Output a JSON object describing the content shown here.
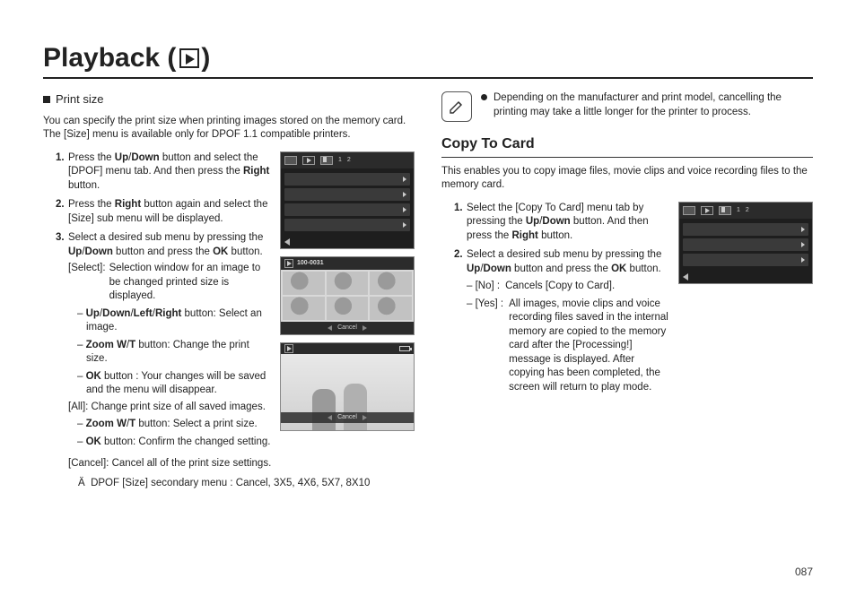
{
  "page": {
    "title_prefix": "Playback (",
    "title_suffix": ")",
    "number": "087"
  },
  "left": {
    "subhead": "Print size",
    "intro": "You can specify the print size when printing images stored on the memory card. The [Size] menu is available only for DPOF 1.1 compatible printers.",
    "steps": {
      "s1": {
        "num": "1.",
        "a": "Press the ",
        "b1": "Up",
        "sep": "/",
        "b2": "Down",
        "c": " button and select the [DPOF] menu tab. And then press the ",
        "b3": "Right",
        "d": " button."
      },
      "s2": {
        "num": "2.",
        "a": "Press the ",
        "b1": "Right",
        "c": " button again and select the [Size] sub menu will be displayed."
      },
      "s3": {
        "num": "3.",
        "a": "Select a desired sub menu by pressing the ",
        "b1": "Up",
        "sep": "/",
        "b2": "Down",
        "c": " button and press the ",
        "b3": "OK",
        "d": " button.",
        "select_label": "[Select]:",
        "select_text": "Selection window for an image to be changed printed size is displayed.",
        "nav_a": "– ",
        "nav_b1": "Up",
        "nav_s": "/",
        "nav_b2": "Down",
        "nav_s2": "/",
        "nav_b3": "Left",
        "nav_s3": "/",
        "nav_b4": "Right",
        "nav_c": " button: Select an image.",
        "zoom_a": "– ",
        "zoom_b": "Zoom W",
        "zoom_s": "/",
        "zoom_b2": "T",
        "zoom_c": " button: Change the print size.",
        "ok_a": "– ",
        "ok_b": "OK",
        "ok_c": " button : Your changes will be saved and the menu will disappear.",
        "all_label": "[All]: Change print size of all saved images.",
        "zoom2_a": "– ",
        "zoom2_b": "Zoom W",
        "zoom2_s": "/",
        "zoom2_b2": "T",
        "zoom2_c": " button: Select a print size.",
        "ok2_a": "– ",
        "ok2_b": "OK",
        "ok2_c": " button: Confirm the changed setting.",
        "cancel": "[Cancel]: Cancel all of the print size settings.",
        "note_mark": "Ä",
        "note": "DPOF [Size] secondary menu : Cancel, 3X5, 4X6, 5X7, 8X10"
      }
    },
    "screens": {
      "grid_id": "100-0031",
      "cancel": "Cancel",
      "tab1": "1",
      "tab2": "2"
    }
  },
  "right": {
    "tip": "Depending on the manufacturer and print model, cancelling the printing may take a little longer for the printer to process.",
    "section": "Copy To Card",
    "intro": "This enables you to copy image files, movie clips and voice recording files to the memory card.",
    "steps": {
      "s1": {
        "num": "1.",
        "a": "Select the [Copy To Card] menu tab by pressing the ",
        "b1": "Up",
        "sep": "/",
        "b2": "Down",
        "c": " button. And then press the ",
        "b3": "Right",
        "d": " button."
      },
      "s2": {
        "num": "2.",
        "a": "Select a desired sub menu by pressing the ",
        "b1": "Up",
        "sep": "/",
        "b2": "Down",
        "c": " button and press the ",
        "b3": "OK",
        "d": " button.",
        "no_a": "– [No] :",
        "no_b": "Cancels [Copy to Card].",
        "yes_a": "– [Yes] :",
        "yes_b": "All images, movie clips and voice recording files saved in the internal memory are copied to the memory card after the [Processing!] message is displayed. After copying has been completed, the screen will return to play mode."
      }
    },
    "screens": {
      "tab1": "1",
      "tab2": "2"
    }
  }
}
